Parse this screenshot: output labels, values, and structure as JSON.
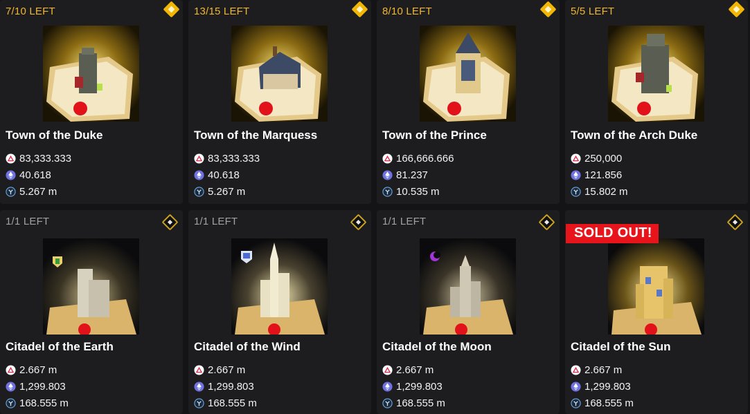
{
  "cards": [
    {
      "left": "7/10 LEFT",
      "title": "Town of the Duke",
      "price_primary": "83,333.333",
      "price_eth": "40.618",
      "price_usd": "5.267 m",
      "badge": "gold-diamond-icon",
      "accent": "#f0b62f"
    },
    {
      "left": "13/15 LEFT",
      "title": "Town of the Marquess",
      "price_primary": "83,333.333",
      "price_eth": "40.618",
      "price_usd": "5.267 m",
      "badge": "gold-diamond-icon",
      "accent": "#f0b62f"
    },
    {
      "left": "8/10 LEFT",
      "title": "Town of the Prince",
      "price_primary": "166,666.666",
      "price_eth": "81.237",
      "price_usd": "10.535 m",
      "badge": "gold-diamond-icon",
      "accent": "#f0b62f"
    },
    {
      "left": "5/5 LEFT",
      "title": "Town of the Arch Duke",
      "price_primary": "250,000",
      "price_eth": "121.856",
      "price_usd": "15.802 m",
      "badge": "gold-diamond-icon",
      "accent": "#f0b62f"
    },
    {
      "left": "1/1 LEFT",
      "title": "Citadel of the Earth",
      "price_primary": "2.667 m",
      "price_eth": "1,299.803",
      "price_usd": "168.555 m",
      "badge": "dark-diamond-icon",
      "accent": "#a2a2a6"
    },
    {
      "left": "1/1 LEFT",
      "title": "Citadel of the Wind",
      "price_primary": "2.667 m",
      "price_eth": "1,299.803",
      "price_usd": "168.555 m",
      "badge": "dark-diamond-icon",
      "accent": "#a2a2a6"
    },
    {
      "left": "1/1 LEFT",
      "title": "Citadel of the Moon",
      "price_primary": "2.667 m",
      "price_eth": "1,299.803",
      "price_usd": "168.555 m",
      "badge": "dark-diamond-icon",
      "accent": "#a2a2a6"
    },
    {
      "left": "",
      "sold_out": "SOLD OUT!",
      "title": "Citadel of the Sun",
      "price_primary": "2.667 m",
      "price_eth": "1,299.803",
      "price_usd": "168.555 m",
      "badge": "dark-diamond-icon",
      "accent": "#e8141c"
    }
  ],
  "icons": {
    "primary_currency": "red-triangle-token-icon",
    "eth_currency": "ethereum-icon",
    "usd_currency": "dollar-coin-icon"
  },
  "colors": {
    "background": "#141416",
    "card": "#1d1d20",
    "gold": "#f0b62f",
    "sold_out": "#e8141c"
  }
}
